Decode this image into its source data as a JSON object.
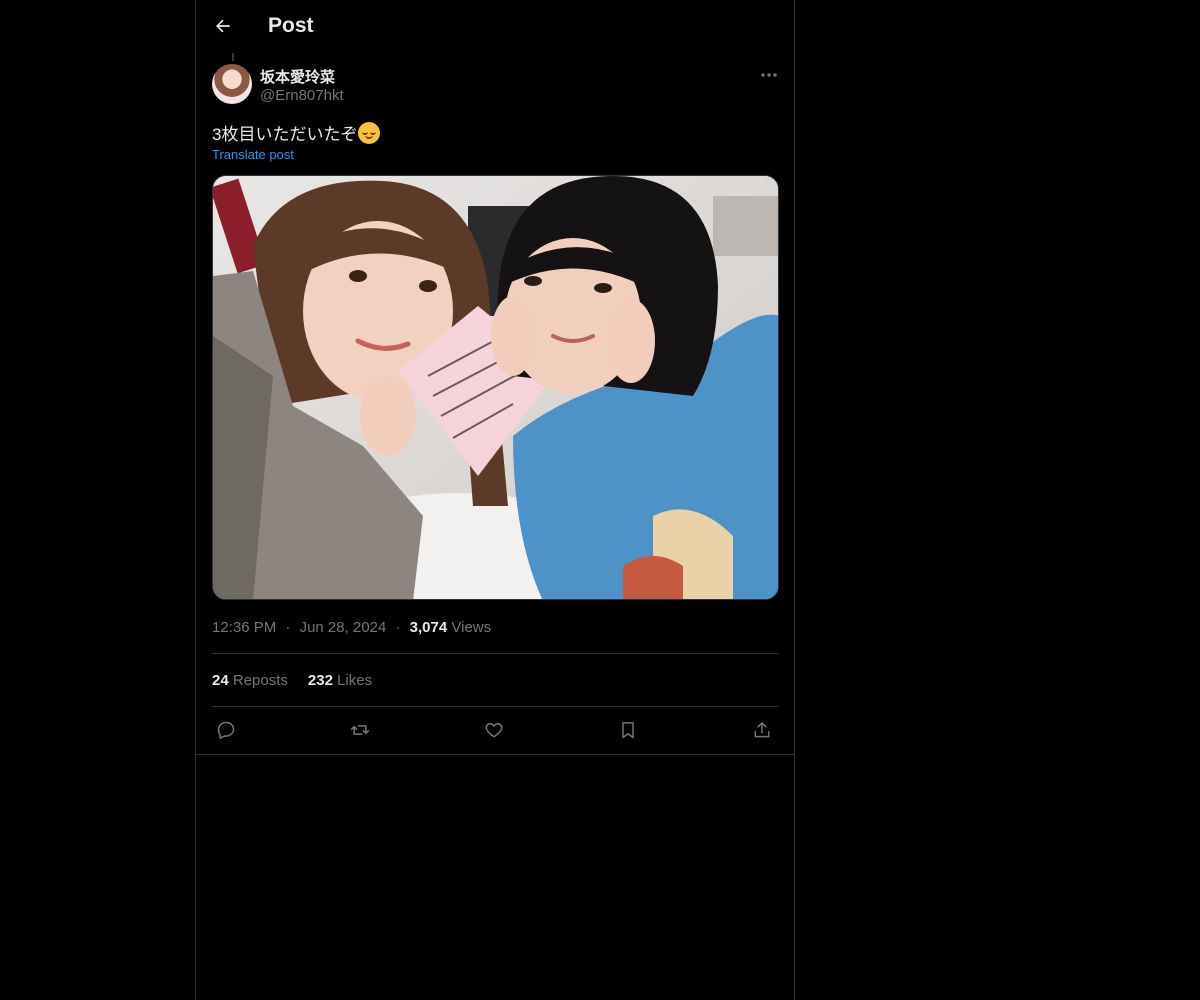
{
  "header": {
    "title": "Post",
    "back_icon": "arrow-left-icon"
  },
  "author": {
    "display_name": "坂本愛玲菜",
    "handle": "@Ern807hkt",
    "avatar_icon": "avatar-photo"
  },
  "post": {
    "text": "3枚目いただいたぞ",
    "emoji": "relieved-face-emoji",
    "translate_label": "Translate post",
    "image_alt": "photo"
  },
  "meta": {
    "time": "12:36 PM",
    "separator": "·",
    "date": "Jun 28, 2024",
    "views_count": "3,074",
    "views_label": "Views"
  },
  "stats": {
    "reposts_count": "24",
    "reposts_label": "Reposts",
    "likes_count": "232",
    "likes_label": "Likes"
  },
  "actions": {
    "reply_icon": "reply-icon",
    "repost_icon": "repost-icon",
    "like_icon": "heart-icon",
    "bookmark_icon": "bookmark-icon",
    "share_icon": "share-icon"
  },
  "colors": {
    "background": "#000000",
    "text_primary": "#e7e9ea",
    "text_secondary": "#71767b",
    "link": "#1d9bf0",
    "border": "#2f3336"
  }
}
